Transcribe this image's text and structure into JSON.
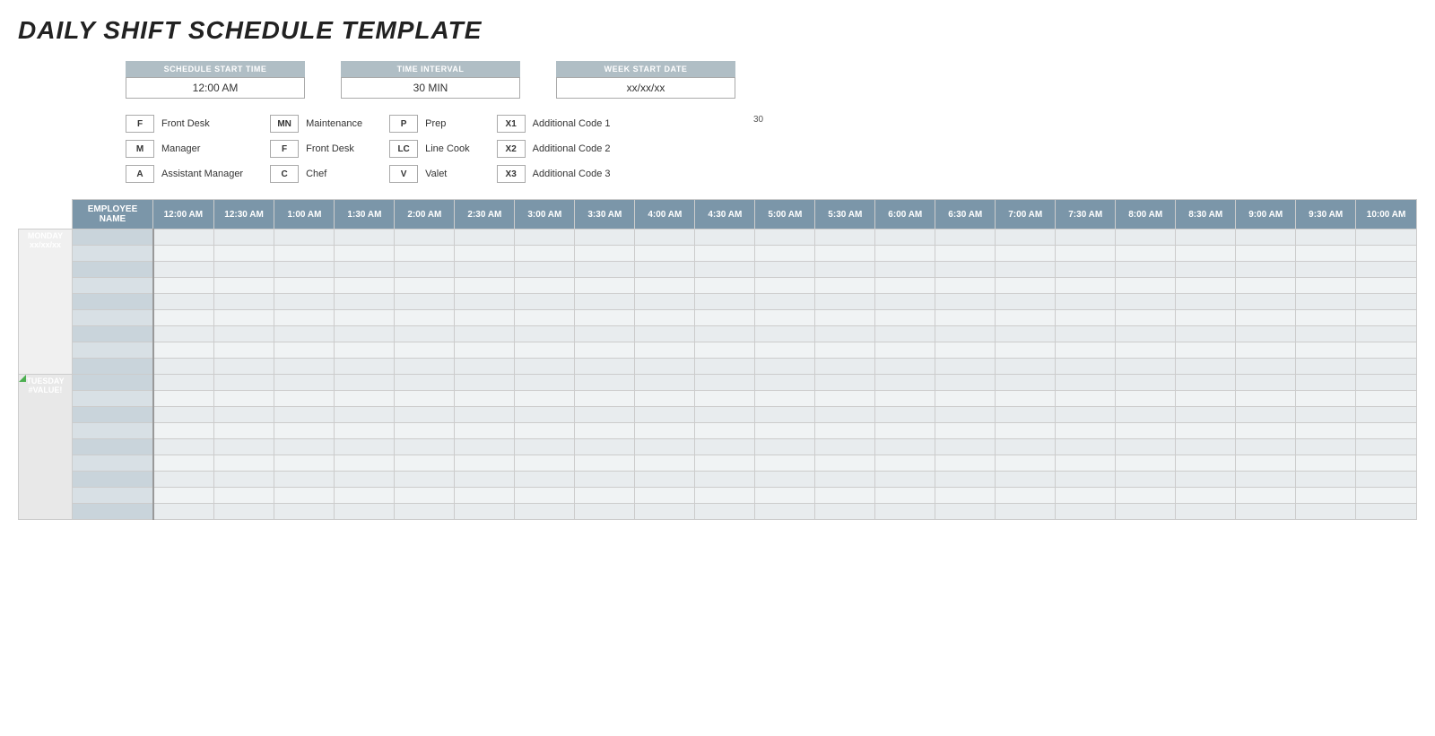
{
  "title": "DAILY SHIFT SCHEDULE TEMPLATE",
  "controls": {
    "schedule_start_time": {
      "label": "SCHEDULE START TIME",
      "value": "12:00 AM"
    },
    "time_interval": {
      "label": "TIME INTERVAL",
      "value": "30 MIN"
    },
    "week_start_date": {
      "label": "WEEK START DATE",
      "value": "xx/xx/xx"
    }
  },
  "legend": [
    {
      "code": "F",
      "description": "Front Desk"
    },
    {
      "code": "M",
      "description": "Manager"
    },
    {
      "code": "A",
      "description": "Assistant Manager"
    },
    {
      "code": "MN",
      "description": "Maintenance"
    },
    {
      "code": "F",
      "description": "Front Desk"
    },
    {
      "code": "C",
      "description": "Chef"
    },
    {
      "code": "P",
      "description": "Prep"
    },
    {
      "code": "LC",
      "description": "Line Cook"
    },
    {
      "code": "V",
      "description": "Valet"
    },
    {
      "code": "X1",
      "description": "Additional Code 1"
    },
    {
      "code": "X2",
      "description": "Additional Code 2"
    },
    {
      "code": "X3",
      "description": "Additional Code 3"
    }
  ],
  "number_hint": "30",
  "time_columns": [
    "12:00 AM",
    "12:30 AM",
    "1:00 AM",
    "1:30 AM",
    "2:00 AM",
    "2:30 AM",
    "3:00 AM",
    "3:30 AM",
    "4:00 AM",
    "4:30 AM",
    "5:00 AM",
    "5:30 AM",
    "6:00 AM",
    "6:30 AM",
    "7:00 AM",
    "7:30 AM",
    "8:00 AM",
    "8:30 AM",
    "9:00 AM",
    "9:30 AM",
    "10:00 AM"
  ],
  "days": [
    {
      "name": "MONDAY",
      "date": "xx/xx/xx",
      "rows": 9
    },
    {
      "name": "TUESDAY",
      "date": "#VALUE!",
      "rows": 9
    }
  ],
  "header": {
    "employee_name": "EMPLOYEE NAME"
  }
}
